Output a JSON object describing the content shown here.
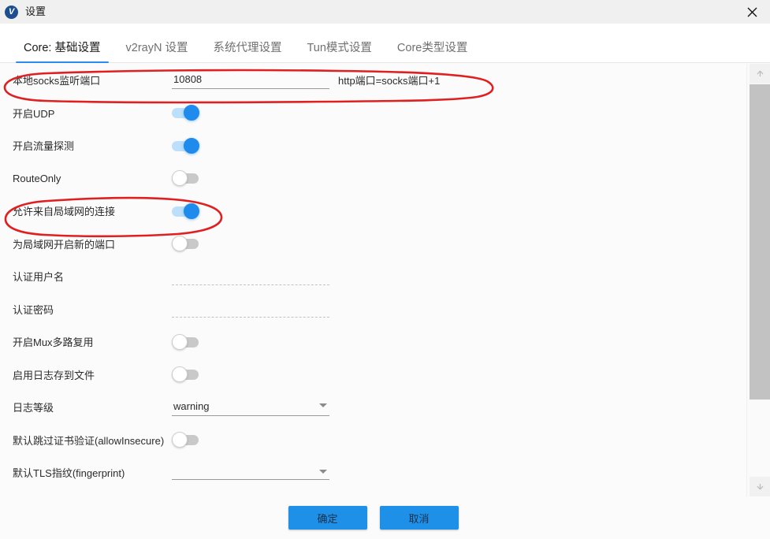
{
  "window": {
    "title": "设置",
    "icon": "v2ray-logo-icon",
    "close_label": "×"
  },
  "tabs": [
    {
      "label": "Core: 基础设置",
      "active": true
    },
    {
      "label": "v2rayN 设置",
      "active": false
    },
    {
      "label": "系统代理设置",
      "active": false
    },
    {
      "label": "Tun模式设置",
      "active": false
    },
    {
      "label": "Core类型设置",
      "active": false
    }
  ],
  "form": {
    "socks_port": {
      "label": "本地socks监听端口",
      "value": "10808",
      "placeholder": "",
      "hint": "http端口=socks端口+1"
    },
    "udp": {
      "label": "开启UDP",
      "state": "on"
    },
    "sniffing": {
      "label": "开启流量探测",
      "state": "on"
    },
    "route_only": {
      "label": "RouteOnly",
      "state": "off"
    },
    "allow_lan": {
      "label": "允许来自局域网的连接",
      "state": "on"
    },
    "new_port_lan": {
      "label": "为局域网开启新的端口",
      "state": "off"
    },
    "auth_user": {
      "label": "认证用户名",
      "value": "",
      "placeholder": "",
      "disabled": true
    },
    "auth_pass": {
      "label": "认证密码",
      "value": "",
      "placeholder": "",
      "disabled": true
    },
    "mux": {
      "label": "开启Mux多路复用",
      "state": "off"
    },
    "log_to_file": {
      "label": "启用日志存到文件",
      "state": "off"
    },
    "log_level": {
      "label": "日志等级",
      "value": "warning"
    },
    "allow_insecure": {
      "label": "默认跳过证书验证(allowInsecure)",
      "state": "off"
    },
    "fingerprint": {
      "label": "默认TLS指纹(fingerprint)",
      "value": ""
    }
  },
  "footer": {
    "ok_label": "确定",
    "cancel_label": "取消"
  },
  "scrollbar": {
    "up_arrow": "scroll-up-arrow",
    "down_arrow": "scroll-down-arrow"
  },
  "annotations": {
    "ellipse_1_target": "本地socks监听端口",
    "ellipse_2_target": "允许来自局域网的连接",
    "color": "#e02020"
  },
  "colors": {
    "accent": "#2d8cf0",
    "button": "#1f90e8",
    "toggle_on": "#1f8ced",
    "toggle_on_track": "#bcdffb",
    "toggle_off_track": "#c9c9c9",
    "annotation_red": "#e02020"
  }
}
